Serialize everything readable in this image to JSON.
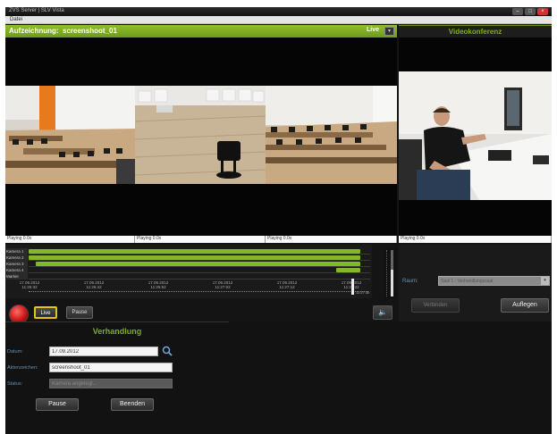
{
  "window": {
    "title": "ZVS Server | SLV Vista",
    "minimize": "–",
    "maximize": "□",
    "close": "×"
  },
  "menu": {
    "file": "Datei"
  },
  "recording": {
    "label": "Aufzeichnung:",
    "name": "screenshoot_01",
    "live_tag": "Live",
    "dropdown": "▾"
  },
  "videoconference": {
    "title": "Videokonferenz"
  },
  "status_strips": [
    "Playing 0.0x",
    "Playing 0.0x",
    "Playing 0.0x",
    "Playing 0.0x"
  ],
  "timeline": {
    "tracks": [
      {
        "name": "Kamera 1",
        "start": 0.0,
        "end": 0.97
      },
      {
        "name": "Kamera 2",
        "start": 0.0,
        "end": 0.97
      },
      {
        "name": "Kamera 3",
        "start": 0.02,
        "end": 0.97
      },
      {
        "name": "Kamera 4",
        "start": 0.9,
        "end": 0.97
      },
      {
        "name": "Marker",
        "start": null,
        "end": null
      }
    ],
    "time_labels": [
      {
        "date": "17.09.2012",
        "time": "11:26:32"
      },
      {
        "date": "17.09.2012",
        "time": "11:26:42"
      },
      {
        "date": "17.09.2012",
        "time": "11:26:52"
      },
      {
        "date": "17.09.2012",
        "time": "11:27:02"
      },
      {
        "date": "17.09.2012",
        "time": "11:27:12"
      },
      {
        "date": "17.09.2012",
        "time": "11:27:22"
      }
    ],
    "end_time": "11:27:30",
    "playhead_fraction": 0.96
  },
  "volume": {
    "level_fraction": 0.58
  },
  "transport": {
    "live_label": "Live",
    "pause_label": "Pause",
    "mute_icon": "🔈"
  },
  "raum": {
    "label": "Raum:",
    "selected": "Saal 1 - Verhandlungssaal",
    "arrow": "▾",
    "connect_label": "Verbinden",
    "hangup_label": "Auflegen"
  },
  "verhandlung": {
    "title": "Verhandlung",
    "datum_label": "Datum:",
    "datum_value": "17.09.2012",
    "akten_label": "Aktenzeichen:",
    "akten_value": "screenshoot_01",
    "status_label": "Status:",
    "status_value": "Kamera angelegt...",
    "pause_label": "Pause",
    "end_label": "Beenden"
  },
  "colors": {
    "accent_green": "#7fae1f",
    "record_red": "#c41010",
    "live_highlight": "#e8c21a"
  }
}
